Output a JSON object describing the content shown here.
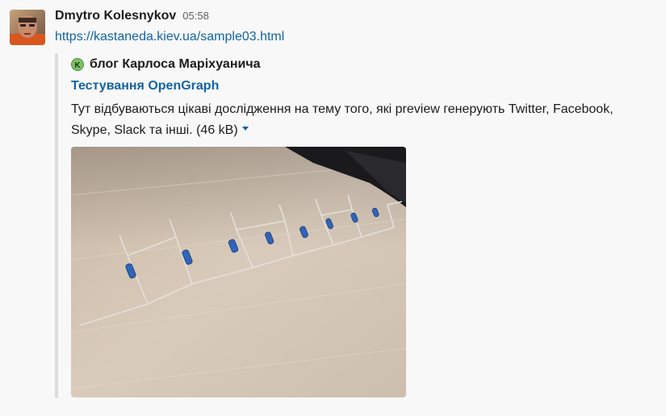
{
  "message": {
    "sender": "Dmytro Kolesnykov",
    "timestamp": "05:58",
    "link": "https://kastaneda.kiev.ua/sample03.html"
  },
  "attachment": {
    "service_icon_letter": "K",
    "service_name": "блог Карлоса Маріхуанича",
    "title": "Тестування OpenGraph",
    "text": "Тут відбуваються цікаві дослідження на тему того, які preview генерують Twitter, Facebook, Skype, Slack та інші. (46 kB)",
    "image_icon": "resistors-photo"
  },
  "colors": {
    "link": "#1264a3",
    "text": "#1d1c1d",
    "muted": "#616061",
    "attachment_bar": "#dddddd",
    "service_icon_fill": "#7fbf6a"
  }
}
